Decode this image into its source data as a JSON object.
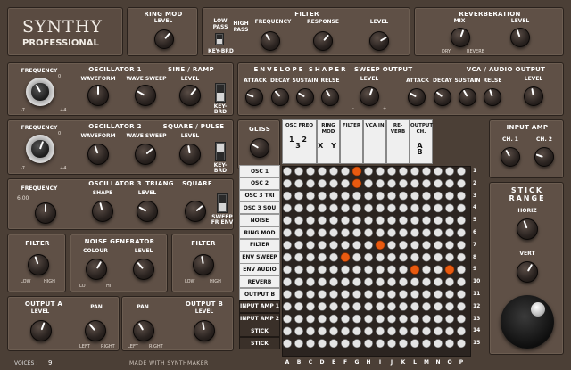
{
  "app": {
    "name": "SYNTHY",
    "subtitle": "PROFESSIONAL",
    "voices_label": "VOICES :",
    "voices_value": "9",
    "footer": "MADE WITH SYNTHMAKER"
  },
  "ring_mod": {
    "title": "RING MOD",
    "level": "LEVEL",
    "min": "0",
    "max": "10"
  },
  "filter_top": {
    "title": "FILTER",
    "low_pass": "LOW PASS",
    "high_pass": "HIGH PASS",
    "key_brd": "KEY-BRD",
    "frequency": "FREQUENCY",
    "response": "RESPONSE",
    "level": "LEVEL",
    "min": "0",
    "max": "10"
  },
  "reverb": {
    "title": "REVERBERATION",
    "mix": "MIX",
    "level": "LEVEL",
    "dry": "DRY",
    "wet": "REVERB",
    "min": "0",
    "max": "10"
  },
  "osc1": {
    "title": "OSCILLATOR 1",
    "wave": "SINE / RAMP",
    "frequency": "FREQUENCY",
    "waveform": "WAVEFORM",
    "wave_sweep": "WAVE SWEEP",
    "level": "LEVEL",
    "key_brd": "KEY-BRD",
    "lo": "-7",
    "hi": "+4",
    "zero": "0",
    "min": "0",
    "max": "10"
  },
  "osc2": {
    "title": "OSCILLATOR 2",
    "wave": "SQUARE / PULSE",
    "frequency": "FREQUENCY",
    "waveform": "WAVEFORM",
    "wave_sweep": "WAVE SWEEP",
    "level": "LEVEL",
    "key_brd": "KEY-BRD",
    "lo": "-7",
    "hi": "+4",
    "zero": "0",
    "min": "0",
    "max": "10"
  },
  "osc3": {
    "title": "OSCILLATOR 3",
    "triang": "TRIANG",
    "square": "SQUARE",
    "frequency": "FREQUENCY",
    "freq_value": "6.00",
    "shape": "SHAPE",
    "level": "LEVEL",
    "sweep_fr_env": "SWEEP FR ENV",
    "min": "0",
    "max": "10"
  },
  "envelope": {
    "title": "ENVELOPE SHAPER",
    "sweep_output": "SWEEP OUTPUT",
    "vca_output": "VCA / AUDIO OUTPUT",
    "attack": "ATTACK",
    "decay": "DECAY",
    "sustain": "SUSTAIN",
    "release": "RELSE",
    "level": "LEVEL",
    "minus": "-",
    "plus": "+",
    "min": "0",
    "max": "10",
    "mid": "16"
  },
  "gliss": {
    "title": "GLISS",
    "min": "0",
    "max": "10"
  },
  "matrix": {
    "col_headers": [
      {
        "label": "OSC FREQ",
        "sub": [
          "1",
          "2",
          "3"
        ]
      },
      {
        "label": "RING MOD",
        "sub": [
          "X",
          "Y"
        ]
      },
      {
        "label": "FILTER"
      },
      {
        "label": "VCA IN"
      },
      {
        "label": "RE-VERB"
      },
      {
        "label": "OUTPUT CH.",
        "sub": [
          "A",
          "B"
        ]
      }
    ],
    "rows": [
      "OSC 1",
      "OSC 2",
      "OSC 3 TRI",
      "OSC 3 SQU",
      "NOISE",
      "RING MOD",
      "FILTER",
      "ENV SWEEP",
      "ENV AUDIO",
      "REVERB",
      "OUTPUT B",
      "INPUT AMP 1",
      "INPUT AMP 2",
      "STICK",
      "STICK"
    ],
    "row_numbers": [
      "1",
      "2",
      "3",
      "4",
      "5",
      "6",
      "7",
      "8",
      "9",
      "10",
      "11",
      "12",
      "13",
      "14",
      "15"
    ],
    "col_letters": [
      "A",
      "B",
      "C",
      "D",
      "E",
      "F",
      "G",
      "H",
      "I",
      "J",
      "K",
      "L",
      "M",
      "N",
      "O",
      "P"
    ],
    "active_pins": [
      {
        "row": 1,
        "col": 7
      },
      {
        "row": 2,
        "col": 7
      },
      {
        "row": 7,
        "col": 9
      },
      {
        "row": 8,
        "col": 6
      },
      {
        "row": 9,
        "col": 12
      },
      {
        "row": 9,
        "col": 15
      }
    ]
  },
  "input_amp": {
    "title": "INPUT AMP",
    "ch1": "CH. 1",
    "ch2": "CH. 2",
    "min": "0",
    "max": "10"
  },
  "stick": {
    "title": "STICK RANGE",
    "horiz": "HORIZ",
    "vert": "VERT",
    "min": "0",
    "max": "10"
  },
  "filter_bottom": {
    "title": "FILTER",
    "low": "LOW",
    "high": "HIGH"
  },
  "filter_bottom2": {
    "title": "FILTER",
    "low": "LOW",
    "high": "HIGH"
  },
  "noise": {
    "title": "NOISE GENERATOR",
    "colour": "COLOUR",
    "level": "LEVEL",
    "lo": "LO",
    "hi": "HI",
    "min": "0",
    "max": "10"
  },
  "output_a": {
    "title": "OUTPUT A",
    "level": "LEVEL",
    "pan": "PAN",
    "left": "LEFT",
    "right": "RIGHT",
    "min": "0",
    "max": "10"
  },
  "output_b": {
    "title": "OUTPUT B",
    "level": "LEVEL",
    "pan": "PAN",
    "left": "LEFT",
    "right": "RIGHT",
    "min": "0",
    "max": "10"
  }
}
